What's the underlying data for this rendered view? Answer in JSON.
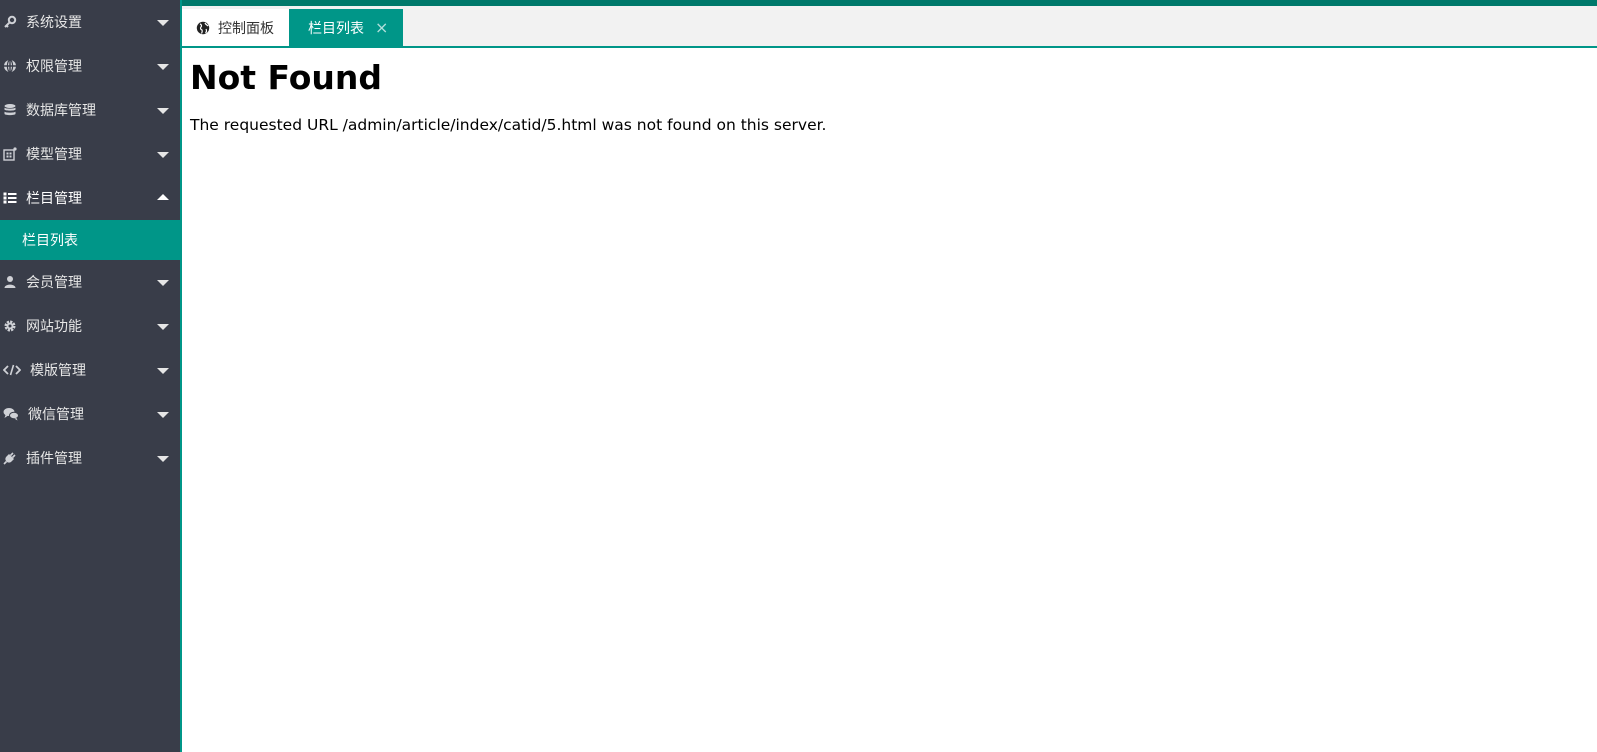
{
  "sidebar": {
    "items": [
      {
        "label": "系统设置",
        "icon": "key-icon",
        "expanded": false
      },
      {
        "label": "权限管理",
        "icon": "globe-icon",
        "expanded": false
      },
      {
        "label": "数据库管理",
        "icon": "database-icon",
        "expanded": false
      },
      {
        "label": "模型管理",
        "icon": "model-icon",
        "expanded": false
      },
      {
        "label": "栏目管理",
        "icon": "list-icon",
        "expanded": true
      },
      {
        "label": "会员管理",
        "icon": "user-icon",
        "expanded": false
      },
      {
        "label": "网站功能",
        "icon": "gear-icon",
        "expanded": false
      },
      {
        "label": "模版管理",
        "icon": "code-icon",
        "expanded": false
      },
      {
        "label": "微信管理",
        "icon": "chat-icon",
        "expanded": false
      },
      {
        "label": "插件管理",
        "icon": "plug-icon",
        "expanded": false
      }
    ],
    "sub_items": [
      {
        "label": "栏目列表",
        "active": true
      }
    ]
  },
  "tabs": [
    {
      "label": "控制面板",
      "icon": "globe-icon",
      "active": false
    },
    {
      "label": "栏目列表",
      "active": true,
      "close": "×"
    }
  ],
  "content": {
    "heading": "Not Found",
    "message": "The requested URL /admin/article/index/catid/5.html was not found on this server."
  },
  "colors": {
    "sidebar_bg": "#393d49",
    "accent": "#009688"
  }
}
